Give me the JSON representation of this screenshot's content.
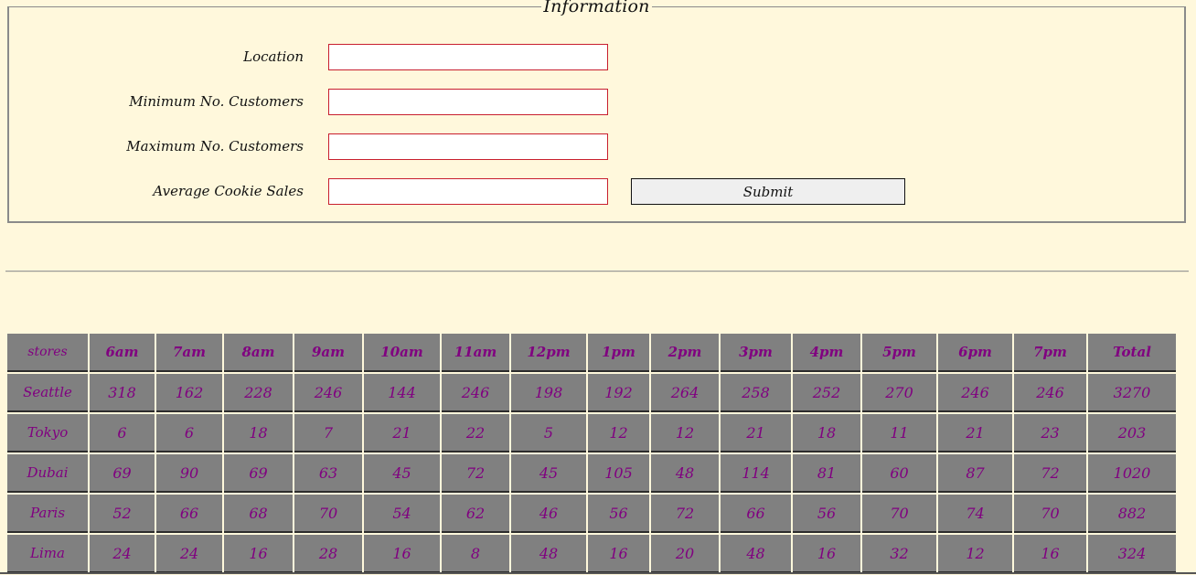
{
  "form": {
    "legend": "Information",
    "fields": [
      {
        "label": "Location",
        "value": ""
      },
      {
        "label": "Minimum No. Customers",
        "value": ""
      },
      {
        "label": "Maximum No. Customers",
        "value": ""
      },
      {
        "label": "Average Cookie Sales",
        "value": ""
      }
    ],
    "submit_label": "Submit"
  },
  "table": {
    "headers": [
      "stores",
      "6am",
      "7am",
      "8am",
      "9am",
      "10am",
      "11am",
      "12pm",
      "1pm",
      "2pm",
      "3pm",
      "4pm",
      "5pm",
      "6pm",
      "7pm",
      "Total"
    ],
    "rows": [
      {
        "store": "Seattle",
        "values": [
          "318",
          "162",
          "228",
          "246",
          "144",
          "246",
          "198",
          "192",
          "264",
          "258",
          "252",
          "270",
          "246",
          "246"
        ],
        "total": "3270"
      },
      {
        "store": "Tokyo",
        "values": [
          "6",
          "6",
          "18",
          "7",
          "21",
          "22",
          "5",
          "12",
          "12",
          "21",
          "18",
          "11",
          "21",
          "23"
        ],
        "total": "203"
      },
      {
        "store": "Dubai",
        "values": [
          "69",
          "90",
          "69",
          "63",
          "45",
          "72",
          "45",
          "105",
          "48",
          "114",
          "81",
          "60",
          "87",
          "72"
        ],
        "total": "1020"
      },
      {
        "store": "Paris",
        "values": [
          "52",
          "66",
          "68",
          "70",
          "54",
          "62",
          "46",
          "56",
          "72",
          "66",
          "56",
          "70",
          "74",
          "70"
        ],
        "total": "882"
      },
      {
        "store": "Lima",
        "values": [
          "24",
          "24",
          "16",
          "28",
          "16",
          "8",
          "48",
          "16",
          "20",
          "48",
          "16",
          "32",
          "12",
          "16"
        ],
        "total": "324"
      }
    ]
  },
  "colors": {
    "page_background": "#fff8dc",
    "table_cell_background": "#808080",
    "table_text": "#800080",
    "input_border": "#c81f2e"
  }
}
